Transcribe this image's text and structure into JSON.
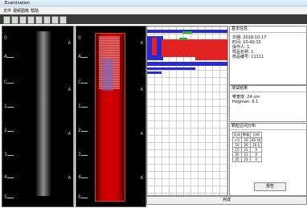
{
  "window": {
    "title": "Examination"
  },
  "menu": {
    "items": [
      "文件",
      "视频图像",
      "帮助"
    ]
  },
  "panels": {
    "left_ruler": [
      "0",
      "A",
      "C",
      "1",
      "2",
      "3",
      "4",
      "5"
    ],
    "right_ruler": [
      "0",
      "A",
      "C",
      "1",
      "2",
      "3",
      "4",
      "5"
    ],
    "side_a_label": "A"
  },
  "info": {
    "title": "基本信息",
    "lines": [
      "日期: 2018-10-17",
      "时间: 10:40:10",
      "操作人: 1",
      "样品名称: 1",
      "样品编号: 11111"
    ]
  },
  "measure": {
    "title": "测试结果",
    "lines": [
      "带宽度: 24 um",
      "Hagman: 6.1"
    ]
  },
  "table": {
    "title": "颗粒区间分布",
    "headers": [
      "区间",
      "数量",
      "比例"
    ],
    "rows": [
      [
        "<5",
        "20",
        "85.50"
      ],
      [
        "10",
        "20",
        "10.5"
      ],
      [
        "15",
        "21",
        "0"
      ],
      [
        "20",
        "21",
        "0"
      ],
      [
        "25",
        "23",
        "0"
      ]
    ]
  },
  "buttons": {
    "report": "报告",
    "bottom": "完成"
  }
}
